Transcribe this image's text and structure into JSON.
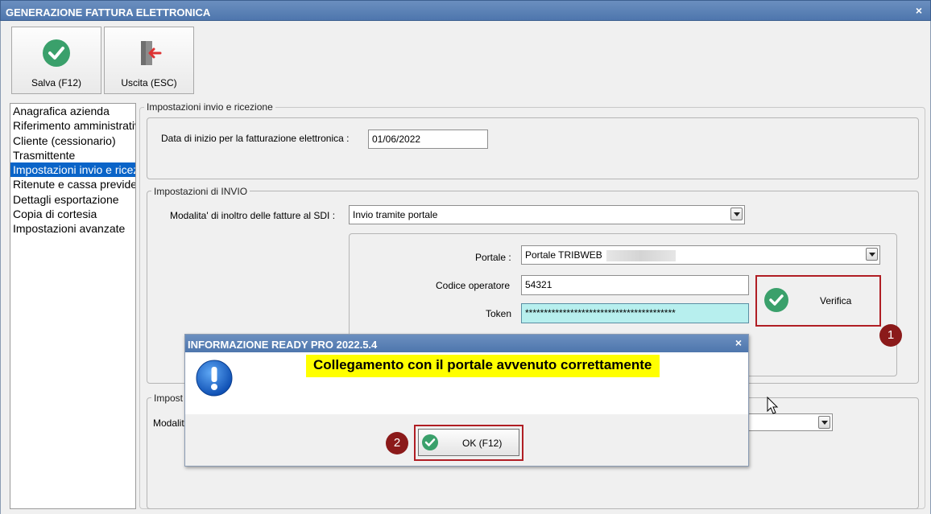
{
  "window": {
    "title": "GENERAZIONE FATTURA ELETTRONICA",
    "close": "×"
  },
  "toolbar": {
    "save_label": "Salva (F12)",
    "exit_label": "Uscita (ESC)"
  },
  "nav": {
    "items": [
      "Anagrafica azienda",
      "Riferimento amministrativo",
      "Cliente (cessionario)",
      "Trasmittente",
      "Impostazioni invio e ricezione",
      "Ritenute e cassa previdenziale",
      "Dettagli esportazione",
      "Copia di cortesia",
      "Impostazioni avanzate"
    ],
    "selected_index": 4
  },
  "group1": {
    "title": "Impostazioni invio e ricezione",
    "start_date_label": "Data di inizio per la fatturazione elettronica :",
    "start_date_value": "01/06/2022"
  },
  "group2": {
    "title": "Impostazioni di INVIO",
    "mode_label": "Modalita' di inoltro delle fatture al SDI :",
    "mode_value": "Invio tramite portale",
    "portal_label": "Portale :",
    "portal_value": "Portale TRIBWEB",
    "operator_label": "Codice operatore",
    "operator_value": "54321",
    "token_label": "Token",
    "token_value": "****************************************",
    "verify_label": "Verifica"
  },
  "group3": {
    "title": "Impost",
    "mode_label": "Modalit"
  },
  "callouts": {
    "one": "1",
    "two": "2"
  },
  "dialog": {
    "title": "INFORMAZIONE READY PRO 2022.5.4",
    "close": "×",
    "message": "Collegamento con il portale avvenuto correttamente",
    "ok_label": "OK (F12)"
  },
  "colors": {
    "titlebar": "#4e76ad",
    "accent_green": "#3aa06b",
    "highlight": "#ffff00",
    "callout_red": "#b01e24"
  }
}
